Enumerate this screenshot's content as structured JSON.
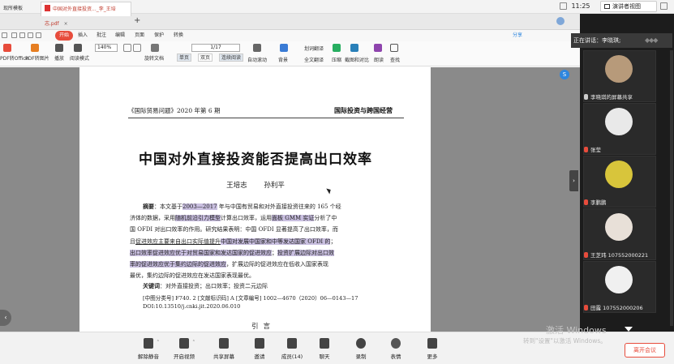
{
  "meeting_top": {
    "clock": "11:25",
    "view_mode": "演讲者视图"
  },
  "tabs": [
    {
      "label": "现所模板"
    },
    {
      "label": "中国对外直接投资..._李_王培志.pdf"
    }
  ],
  "menu": [
    "开始",
    "插入",
    "批注",
    "编辑",
    "页面",
    "保护",
    "转换"
  ],
  "ribbon": {
    "zoom": "140%",
    "page": "1/17",
    "share": "分享",
    "labels": [
      "PDF转Office",
      "PDF转图片",
      "播放",
      "阅读模式",
      "旋转文档",
      "自动滚动",
      "背景",
      "全文翻译",
      "压缩",
      "截图和对比",
      "朗读",
      "查找"
    ],
    "modes": [
      "单页",
      "双页",
      "连续阅读"
    ],
    "translate": "划词翻译"
  },
  "document": {
    "journal": "《国际贸易问题》2020 年第 6 期",
    "section": "国际投资与跨国经营",
    "title": "中国对外直接投资能否提高出口效率",
    "authors": "王培志  孙利平",
    "abstract_label": "摘要",
    "abstract_lines": [
      {
        "pre": "：本文基于",
        "hl": "2003—2017",
        "post": " 年与中国有贸易和对外直接投资往来的 165 个经"
      },
      {
        "pre": "济体的数据，采用",
        "hl": "随机前沿引力模型",
        "post": "计算出口效率，运用",
        "hl2": "面板 GMM 实证",
        "post2": "分析了中"
      },
      {
        "pre": "国 OFDI 对出口效率的作用。研究结果表明：中国 OFDI 显著提高了出口效率，而"
      },
      {
        "pre": "且",
        "ul": "促进效应主要来自出口实际值提升",
        "post": "；",
        "hl": "中国对发展中国家和中等发达国家 OFDI 的"
      },
      {
        "hl": "出口效率促进效应优于对贸易国家和发达国家的促进效应",
        "post": "；",
        "hl2": "投资扩展边际对出口效"
      },
      {
        "hl": "率的促进效应优于集约边际的促进效应",
        "post": "，扩展边际的促进效应在低收入国家表现"
      },
      {
        "pre": "最优，集约边际的促进效应在发达国家表现最优。"
      }
    ],
    "keywords_label": "关键词",
    "keywords": "：对外直接投资；出口效率；投资二元边际",
    "meta1": "[中图分类号]  F740. 2      [文献标识码]  A      [文章编号]  1002—4670（2020）06—0143—17",
    "meta2": "DOI:10.13510/j.cnki.jit.2020.06.010",
    "intro": "引言",
    "side_badge": "S"
  },
  "panel": {
    "speaking": "正在讲话：李晓琪;",
    "participants": [
      {
        "name": "李晓琪的屏幕共享",
        "avatar_color": "#b79a7a"
      },
      {
        "name": "张莹",
        "avatar_color": "#e9e9e9"
      },
      {
        "name": "李鹏鹏",
        "avatar_color": "#d8c53b"
      },
      {
        "name": "王芝玮 107552000221",
        "avatar_color": "#e8e0d8"
      },
      {
        "name": "田露 107552000206",
        "avatar_color": "#f0f0f0"
      }
    ]
  },
  "toolbar": {
    "buttons": [
      "解除静音",
      "开启视频",
      "共享屏幕",
      "邀请",
      "成员(14)",
      "聊天",
      "录制",
      "表情",
      "更多"
    ],
    "leave": "离开会议"
  },
  "watermark": {
    "line1": "激活 Windows",
    "line2": "转到\"设置\"以激活 Windows。"
  }
}
